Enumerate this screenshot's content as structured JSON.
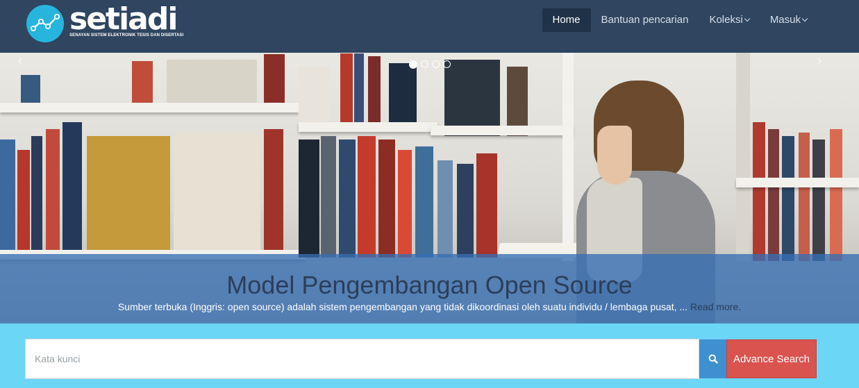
{
  "brand": {
    "name": "setiadi",
    "tagline": "SENAYAN SISTEM ELEKTRONIK TESIS DAN DISERTASI",
    "logo_icon": "line-chart-icon",
    "accent": "#27b5de"
  },
  "nav": {
    "items": [
      {
        "label": "Home",
        "active": true
      },
      {
        "label": "Bantuan pencarian",
        "active": false
      },
      {
        "label": "Koleksi",
        "active": false,
        "dropdown": true
      },
      {
        "label": "Masuk",
        "active": false,
        "dropdown": true
      }
    ]
  },
  "carousel": {
    "slide_count": 4,
    "active_index": 0,
    "prev_glyph": "‹",
    "next_glyph": "›",
    "caption": {
      "title": "Model Pengembangan Open Source",
      "text": "Sumber terbuka (Inggris: open source) adalah sistem pengembangan yang tidak dikoordinasi oleh suatu individu / lembaga pusat, ...",
      "link": "Read more."
    }
  },
  "search": {
    "placeholder": "Kata kunci",
    "value": "",
    "search_icon": "search-icon",
    "advance_label": "Advance Search"
  },
  "colors": {
    "navbar": "#2f4560",
    "search_bg": "#6cd6f6",
    "advance_button": "#d9534f",
    "search_button": "#3e90d0"
  }
}
